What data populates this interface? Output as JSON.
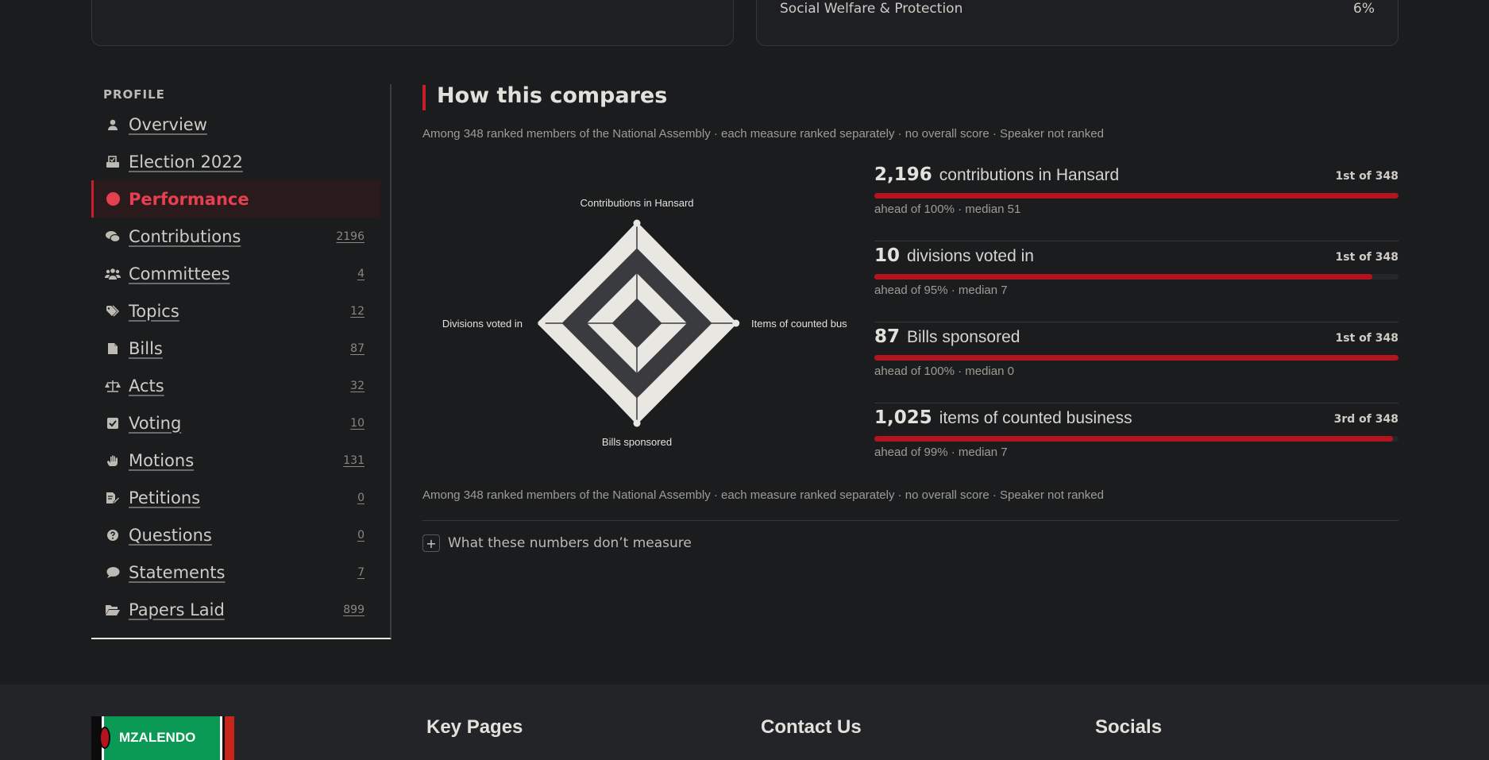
{
  "top_cards": {
    "right_row": {
      "label": "Social Welfare & Protection",
      "value": "6%"
    }
  },
  "sidebar": {
    "heading": "PROFILE",
    "items": [
      {
        "label": "Overview",
        "count": "",
        "icon": "person-icon"
      },
      {
        "label": "Election 2022",
        "count": "",
        "icon": "ballot-box-icon"
      },
      {
        "label": "Performance",
        "count": "",
        "icon": "dot-icon",
        "active": true
      },
      {
        "label": "Contributions",
        "count": "2196",
        "icon": "comments-icon"
      },
      {
        "label": "Committees",
        "count": "4",
        "icon": "people-group-icon"
      },
      {
        "label": "Topics",
        "count": "12",
        "icon": "tags-icon"
      },
      {
        "label": "Bills",
        "count": "87",
        "icon": "file-icon"
      },
      {
        "label": "Acts",
        "count": "32",
        "icon": "scale-icon"
      },
      {
        "label": "Voting",
        "count": "10",
        "icon": "checkbox-icon"
      },
      {
        "label": "Motions",
        "count": "131",
        "icon": "raised-hand-icon"
      },
      {
        "label": "Petitions",
        "count": "0",
        "icon": "file-pen-icon"
      },
      {
        "label": "Questions",
        "count": "0",
        "icon": "question-circle-icon"
      },
      {
        "label": "Statements",
        "count": "7",
        "icon": "speech-bubble-icon"
      },
      {
        "label": "Papers Laid",
        "count": "899",
        "icon": "folder-open-icon"
      }
    ]
  },
  "main": {
    "title": "How this compares",
    "note_top": "Among 348 ranked members of the National Assembly · each measure ranked separately · no overall score · Speaker not ranked",
    "note_bottom": "Among 348 ranked members of the National Assembly · each measure ranked separately · no overall score · Speaker not ranked",
    "expander_label": "What these numbers don’t measure",
    "expander_symbol": "+"
  },
  "chart_data": {
    "type": "radar",
    "axes": [
      "Contributions in Hansard",
      "Items of counted bus",
      "Bills sponsored",
      "Divisions voted in"
    ],
    "series": [
      {
        "values": [
          1.0,
          0.99,
          1.0,
          0.95
        ]
      }
    ],
    "rings": 4,
    "colors": {
      "fill": "#e9e7e2",
      "band": "#3a3b3e",
      "point": "#e9e7e2"
    }
  },
  "measures": [
    {
      "value": "2,196",
      "label": "contributions in Hansard",
      "rank": "1st of 348",
      "percentile": 100,
      "foot": "ahead of 100% · median 51"
    },
    {
      "value": "10",
      "label": "divisions voted in",
      "rank": "1st of 348",
      "percentile": 95,
      "foot": "ahead of 95% · median 7"
    },
    {
      "value": "87",
      "label": "Bills sponsored",
      "rank": "1st of 348",
      "percentile": 100,
      "foot": "ahead of 100% · median 0"
    },
    {
      "value": "1,025",
      "label": "items of counted business",
      "rank": "3rd of 348",
      "percentile": 99,
      "foot": "ahead of 99% · median 7"
    }
  ],
  "footer": {
    "logo_text": "MZALENDO",
    "col1": "Key Pages",
    "col2": "Contact Us",
    "col3": "Socials"
  },
  "colors": {
    "accent": "#c81e2c",
    "bar": "#b3141f",
    "background": "#1b1c1e"
  }
}
